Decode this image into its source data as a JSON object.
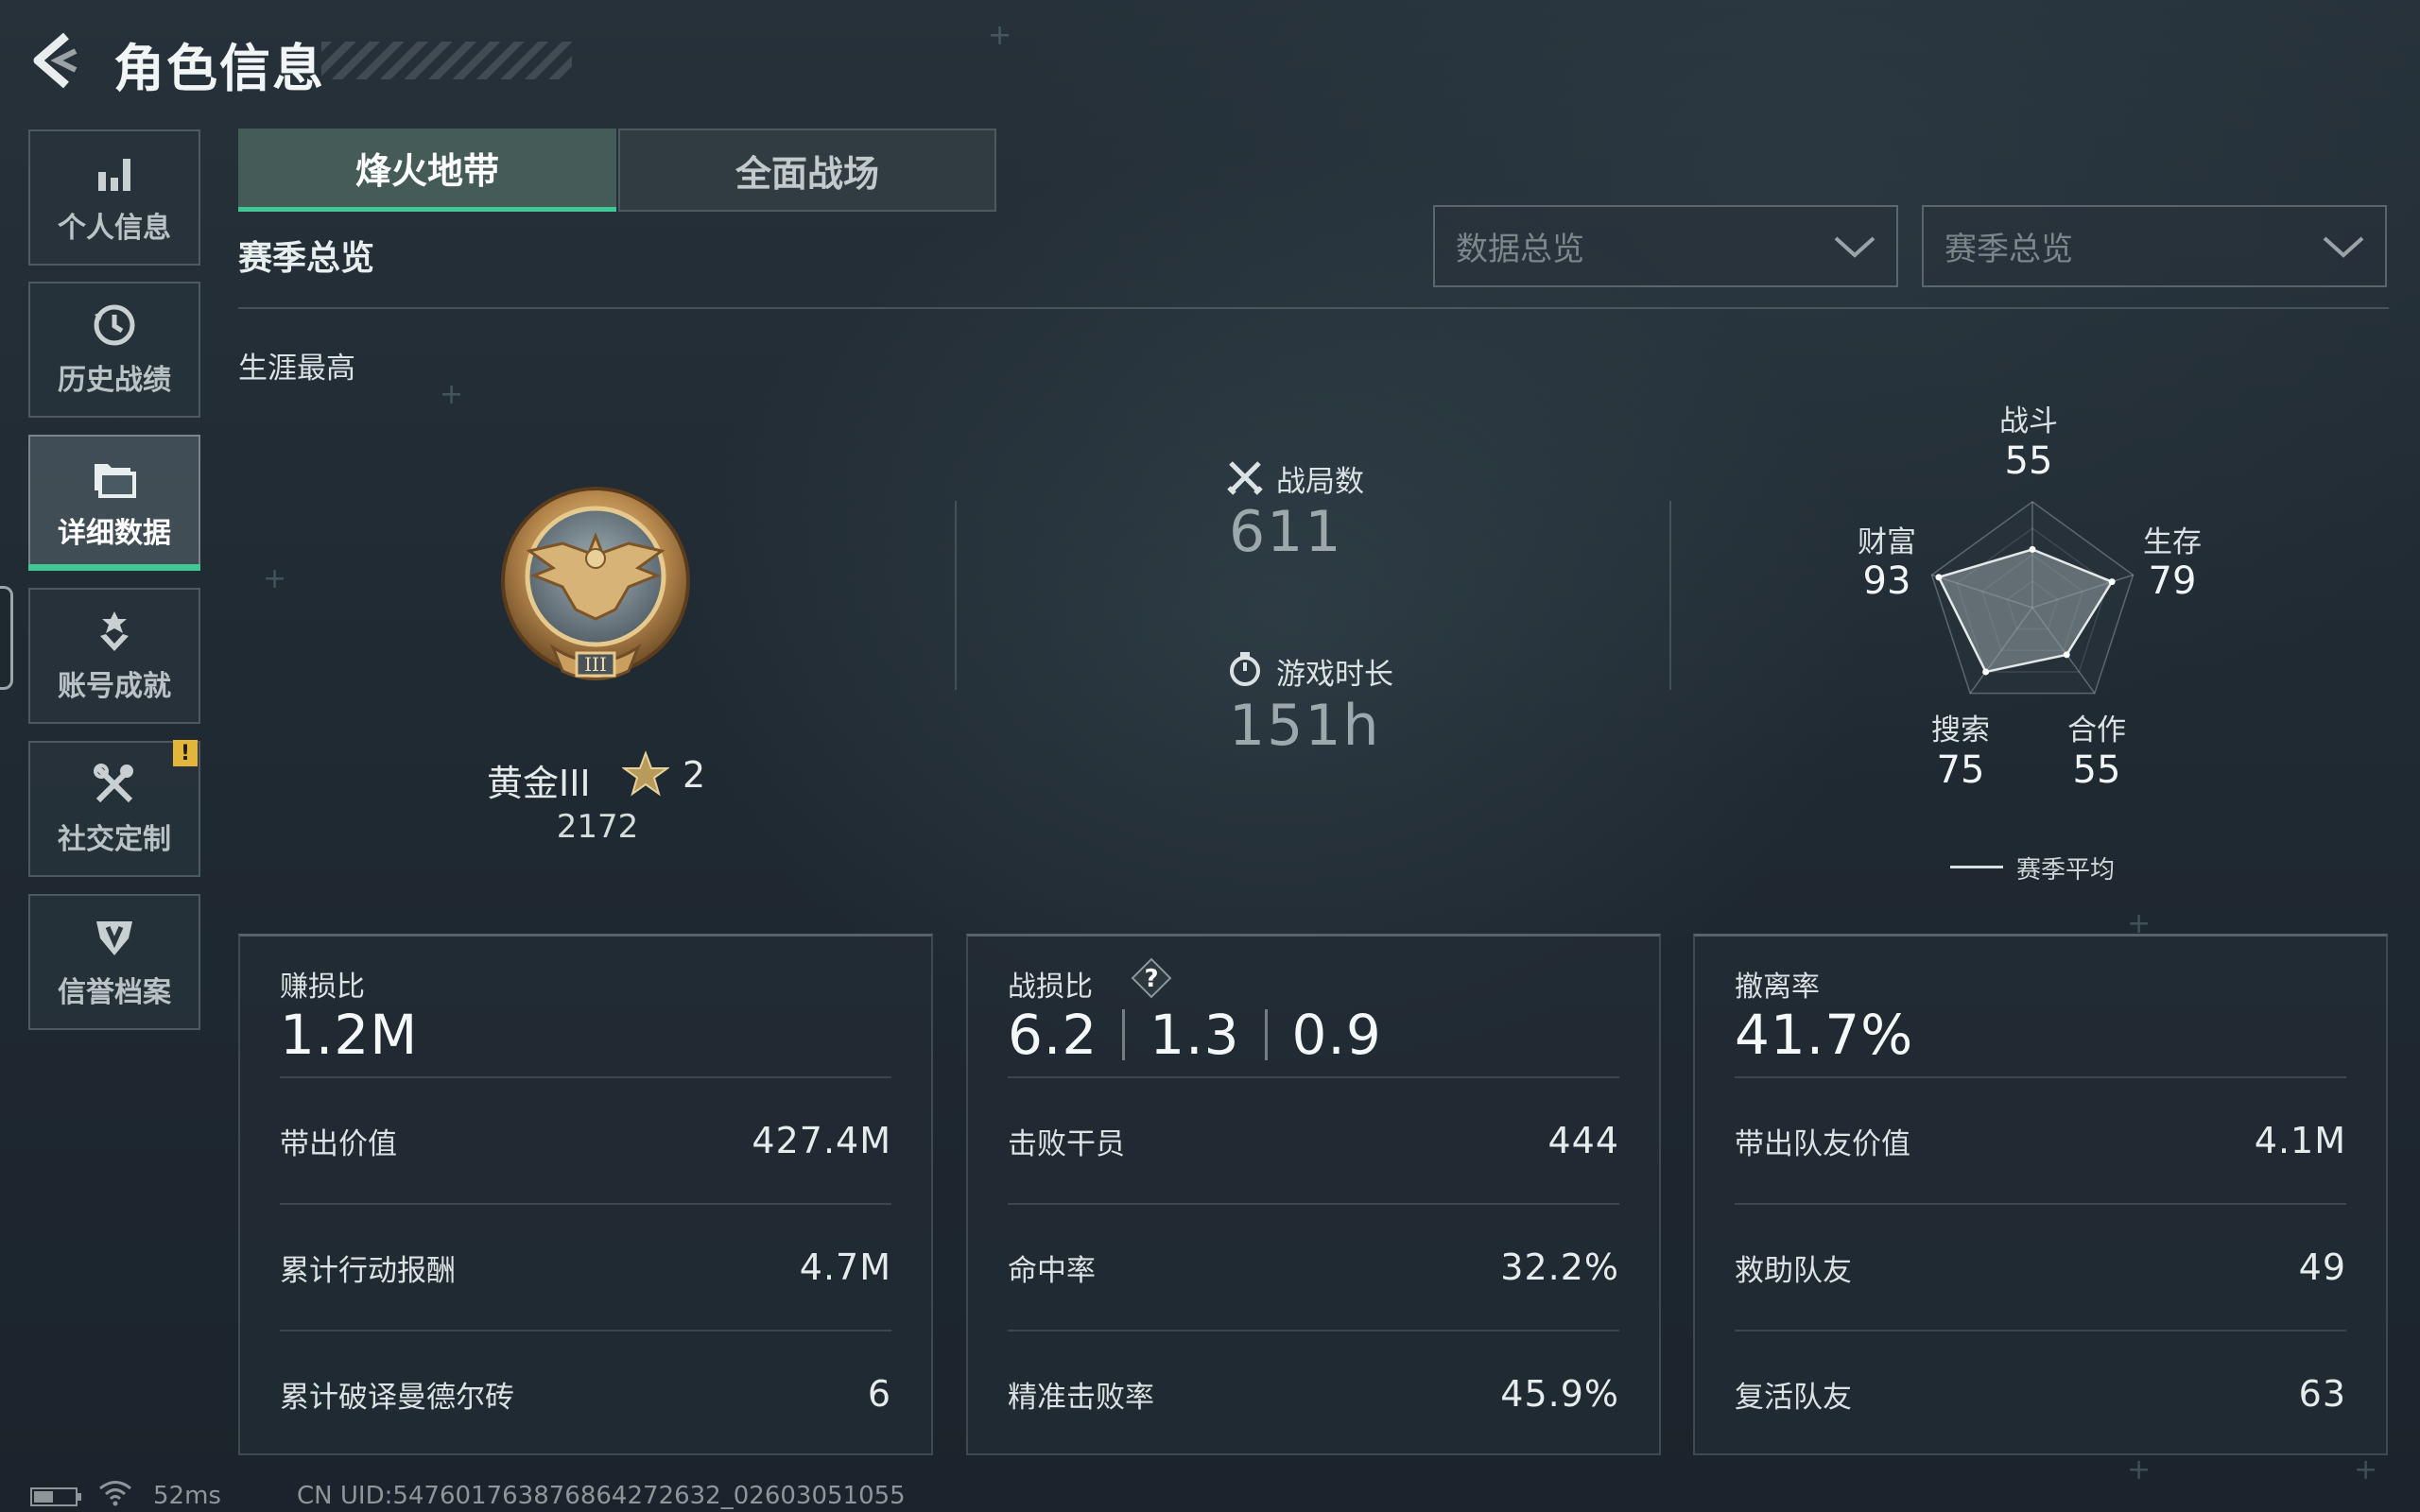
{
  "header": {
    "title": "角色信息"
  },
  "sidebar": {
    "items": [
      {
        "label": "个人信息",
        "icon": "bar-chart-icon"
      },
      {
        "label": "历史战绩",
        "icon": "history-clock-icon"
      },
      {
        "label": "详细数据",
        "icon": "folder-data-icon",
        "active": true
      },
      {
        "label": "账号成就",
        "icon": "achievement-icon"
      },
      {
        "label": "社交定制",
        "icon": "tools-icon",
        "badge": "!"
      },
      {
        "label": "信誉档案",
        "icon": "shield-icon"
      }
    ]
  },
  "tabs": [
    {
      "label": "烽火地带",
      "active": true
    },
    {
      "label": "全面战场",
      "active": false
    }
  ],
  "section_title": "赛季总览",
  "filters": {
    "data_select": "数据总览",
    "season_select": "赛季总览"
  },
  "career": {
    "label": "生涯最高",
    "rank_name": "黄金III",
    "rank_stars": "2",
    "rank_points": "2172",
    "matches_label": "战局数",
    "matches_value": "611",
    "playtime_label": "游戏时长",
    "playtime_value": "151h"
  },
  "radar": {
    "stats": [
      {
        "label": "战斗",
        "value": 55
      },
      {
        "label": "生存",
        "value": 79
      },
      {
        "label": "合作",
        "value": 55
      },
      {
        "label": "搜索",
        "value": 75
      },
      {
        "label": "财富",
        "value": 93
      }
    ],
    "legend": "赛季平均"
  },
  "cards": [
    {
      "title": "赚损比",
      "main": "1.2M",
      "rows": [
        {
          "label": "带出价值",
          "value": "427.4M"
        },
        {
          "label": "累计行动报酬",
          "value": "4.7M"
        },
        {
          "label": "累计破译曼德尔砖",
          "value": "6"
        }
      ]
    },
    {
      "title": "战损比",
      "help": "?",
      "main_values": [
        "6.2",
        "1.3",
        "0.9"
      ],
      "rows": [
        {
          "label": "击败干员",
          "value": "444"
        },
        {
          "label": "命中率",
          "value": "32.2%"
        },
        {
          "label": "精准击败率",
          "value": "45.9%"
        }
      ]
    },
    {
      "title": "撤离率",
      "main": "41.7%",
      "rows": [
        {
          "label": "带出队友价值",
          "value": "4.1M"
        },
        {
          "label": "救助队友",
          "value": "49"
        },
        {
          "label": "复活队友",
          "value": "63"
        }
      ]
    }
  ],
  "footer": {
    "ping": "52ms",
    "uid": "CN UID:547601763876864272632_02603051055"
  },
  "colors": {
    "accent": "#41c696",
    "badge": "#e3b53a",
    "background": "#202a32"
  }
}
